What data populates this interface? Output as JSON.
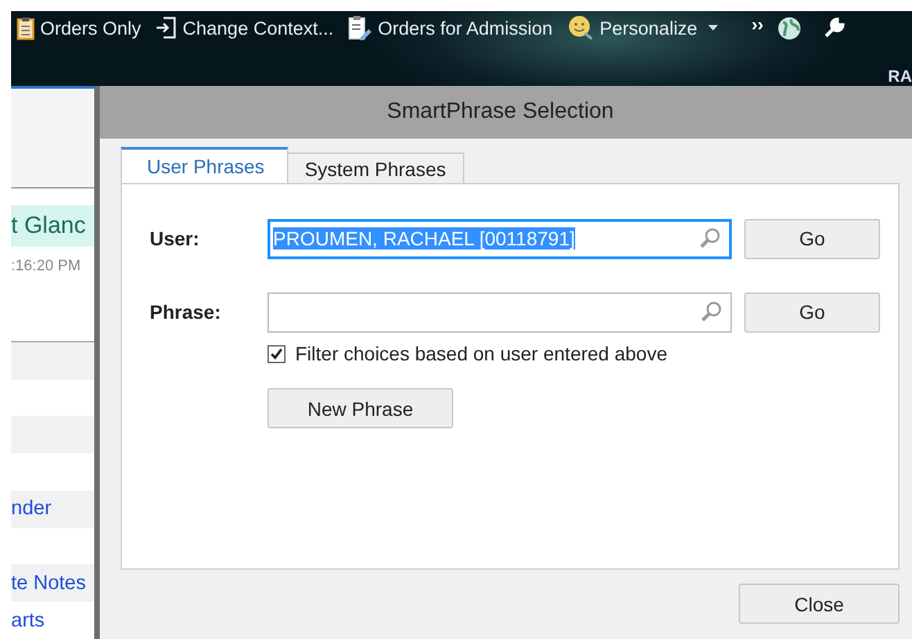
{
  "toolbar": {
    "items": [
      {
        "kind": "clipboard",
        "label": "Orders Only"
      },
      {
        "kind": "enter",
        "label": "Change Context..."
      },
      {
        "kind": "clipboard-pen",
        "label": "Orders for Admission"
      },
      {
        "kind": "smiley",
        "label": "Personalize",
        "dropdown": true
      }
    ],
    "overflow": "››",
    "user": "RA"
  },
  "background_panel": {
    "heading": "t Glanc",
    "time": ":16:20 PM",
    "links": [
      "nder",
      "te Notes",
      "arts"
    ]
  },
  "dialog": {
    "title": "SmartPhrase Selection",
    "tabs": [
      {
        "label": "User Phrases",
        "selected": true
      },
      {
        "label": "System Phrases",
        "selected": false
      }
    ],
    "fields": [
      {
        "label": "User:",
        "value": "PROUMEN, RACHAEL [00118791]",
        "focused": true,
        "button": "Go"
      },
      {
        "label": "Phrase:",
        "focused": false,
        "button": "Go"
      }
    ],
    "filter": {
      "label": "Filter choices based on user entered above",
      "checked": true
    },
    "new_button": {
      "label": "New Phrase"
    },
    "close_button": {
      "label": "Close"
    }
  }
}
